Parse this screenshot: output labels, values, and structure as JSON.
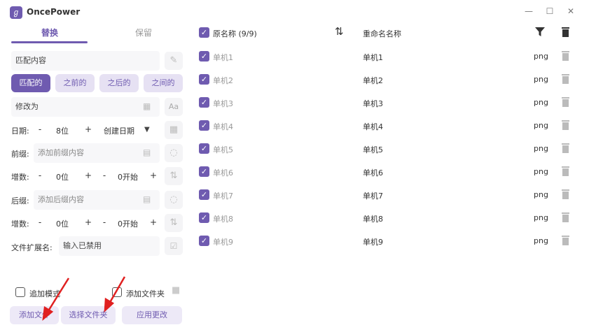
{
  "app": {
    "title": "OncePower"
  },
  "window_controls": {
    "minimize": "—",
    "maximize": "☐",
    "close": "✕"
  },
  "tabs": [
    {
      "label": "替换"
    },
    {
      "label": "保留"
    }
  ],
  "match": {
    "placeholder": "匹配内容"
  },
  "modes": [
    {
      "label": "匹配的"
    },
    {
      "label": "之前的"
    },
    {
      "label": "之后的"
    },
    {
      "label": "之间的"
    }
  ],
  "modify": {
    "placeholder": "修改为",
    "aa": "Aa"
  },
  "date": {
    "label": "日期:",
    "minus": "-",
    "value": "8位",
    "plus": "+",
    "type": "创建日期"
  },
  "prefix": {
    "label": "前缀:",
    "placeholder": "添加前缀内容"
  },
  "increment1": {
    "label": "增数:",
    "minus": "-",
    "value": "0位",
    "plus": "+",
    "minus2": "-",
    "start": "0开始",
    "plus2": "+"
  },
  "suffix": {
    "label": "后缀:",
    "placeholder": "添加后缀内容"
  },
  "increment2": {
    "label": "增数:",
    "minus": "-",
    "value": "0位",
    "plus": "+",
    "minus2": "-",
    "start": "0开始",
    "plus2": "+"
  },
  "extension": {
    "label": "文件扩展名:",
    "placeholder": "输入已禁用"
  },
  "options": {
    "append_mode": "追加模式",
    "add_folder": "添加文件夹"
  },
  "buttons": {
    "add_file": "添加文件",
    "select_folder": "选择文件夹",
    "apply": "应用更改"
  },
  "table": {
    "header_original": "原名称 (9/9)",
    "header_new": "重命名名称",
    "rows": [
      {
        "original": "单机1",
        "new": "单机1",
        "ext": "png"
      },
      {
        "original": "单机2",
        "new": "单机2",
        "ext": "png"
      },
      {
        "original": "单机3",
        "new": "单机3",
        "ext": "png"
      },
      {
        "original": "单机4",
        "new": "单机4",
        "ext": "png"
      },
      {
        "original": "单机5",
        "new": "单机5",
        "ext": "png"
      },
      {
        "original": "单机6",
        "new": "单机6",
        "ext": "png"
      },
      {
        "original": "单机7",
        "new": "单机7",
        "ext": "png"
      },
      {
        "original": "单机8",
        "new": "单机8",
        "ext": "png"
      },
      {
        "original": "单机9",
        "new": "单机9",
        "ext": "png"
      }
    ]
  },
  "colors": {
    "accent": "#6f5bb0",
    "accent_light": "#e6e1f3",
    "arrow": "#e02020"
  }
}
